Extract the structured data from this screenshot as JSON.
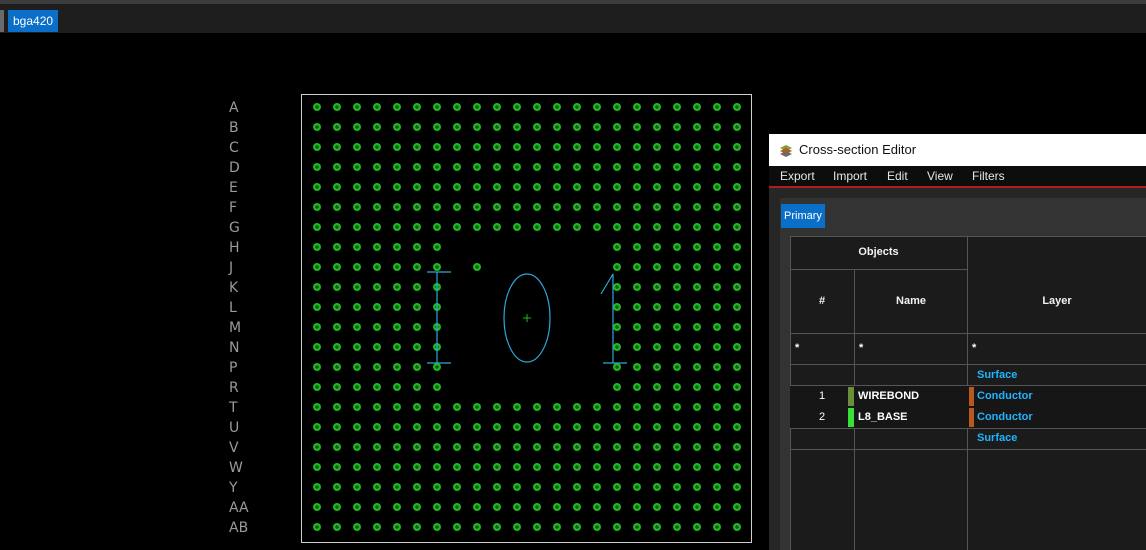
{
  "document_tab": {
    "label": "bga420"
  },
  "colors": {
    "pad": "#20b820",
    "outline": "#cfcfcf",
    "row_label": "#9a9a9a",
    "bondwire": "#2ea8d8",
    "accent": "#0a6fc9",
    "wirebond_swatch": "#6b8e3a",
    "l8base_swatch": "#36e036",
    "layer_swatch": "#b8581e",
    "surface_text": "#1fb4ff"
  },
  "board": {
    "row_labels": [
      "A",
      "B",
      "C",
      "D",
      "E",
      "F",
      "G",
      "H",
      "J",
      "K",
      "L",
      "M",
      "N",
      "P",
      "R",
      "T",
      "U",
      "V",
      "W",
      "Y",
      "AA",
      "AB"
    ],
    "columns": 22,
    "cavity": {
      "row_start": 7,
      "row_end": 14,
      "col_start": 7,
      "col_end": 14
    },
    "extra_pads": [
      [
        7,
        5
      ],
      [
        7,
        6
      ],
      [
        8,
        8
      ]
    ],
    "die_marking": "I 0 1"
  },
  "cross_section_editor": {
    "title": "Cross-section Editor",
    "icon": "layers-stack-icon",
    "menu": [
      "Export",
      "Import",
      "Edit",
      "View",
      "Filters"
    ],
    "active_tab": "Primary",
    "table": {
      "group_header": "Objects",
      "columns": [
        "#",
        "Name",
        "Layer"
      ],
      "filters": [
        "*",
        "*",
        "*"
      ],
      "rows": [
        {
          "num": "",
          "name": "",
          "layer": "Surface"
        },
        {
          "num": "1",
          "name": "WIREBOND",
          "layer": "Conductor"
        },
        {
          "num": "2",
          "name": "L8_BASE",
          "layer": "Conductor"
        },
        {
          "num": "",
          "name": "",
          "layer": "Surface"
        }
      ]
    }
  }
}
